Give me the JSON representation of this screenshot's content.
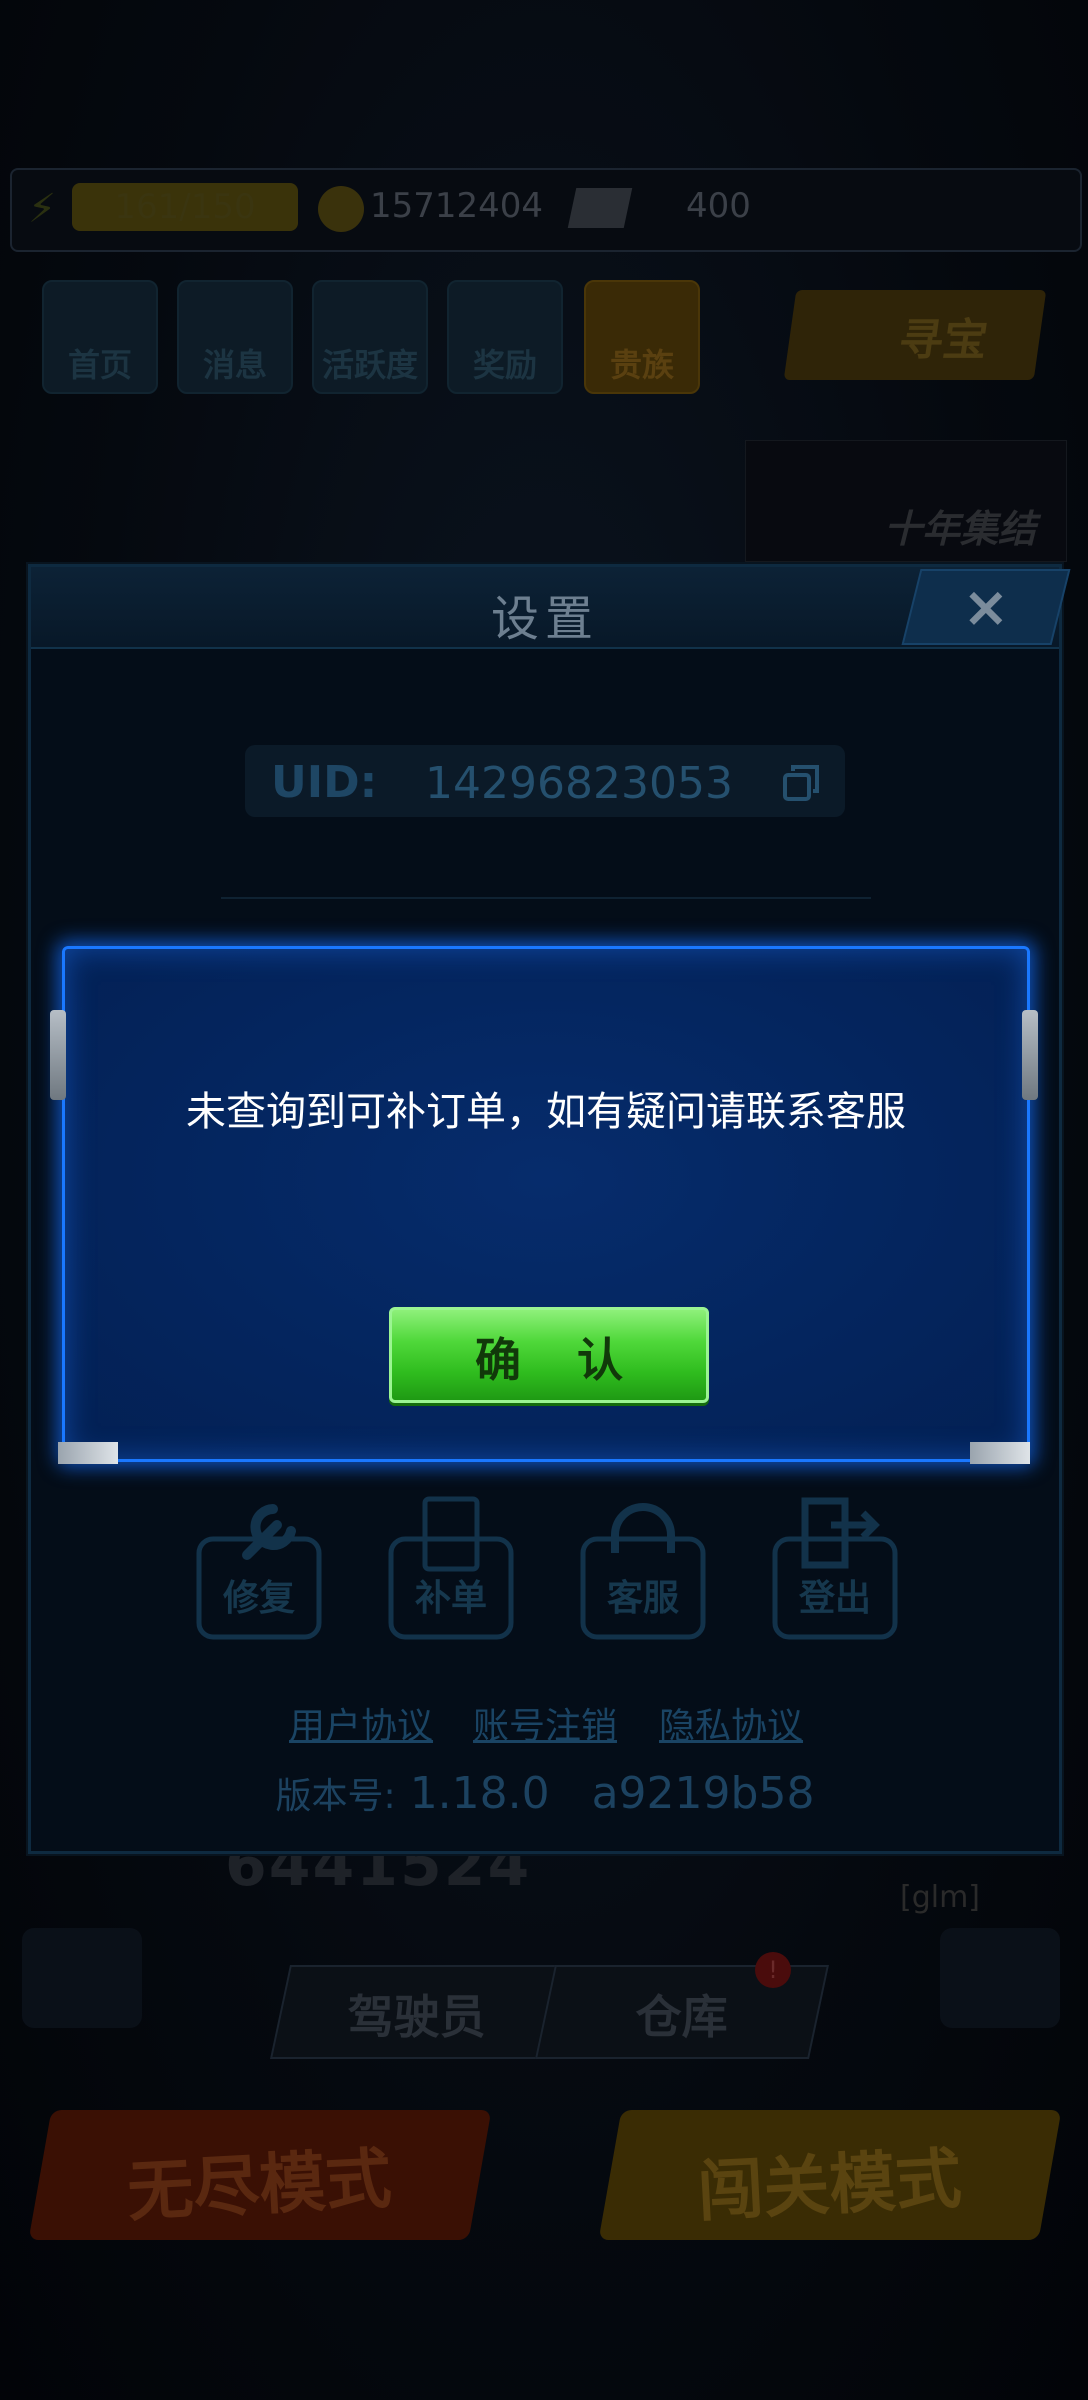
{
  "game_hud": {
    "energy": "161/150",
    "coins": "15712404",
    "tickets": "400",
    "nav": [
      "首页",
      "消息",
      "活跃度",
      "奖励",
      "贵族"
    ],
    "treasure": "寻宝",
    "banner": "十年集结",
    "score": "6441524",
    "user_tag": "[glm]",
    "driver_tab": "驾驶员",
    "warehouse_tab": "仓库",
    "warehouse_badge": "!",
    "endless_mode": "无尽模式",
    "stage_mode": "闯关模式"
  },
  "settings": {
    "title": "设置",
    "close": "×",
    "uid_label": "UID:",
    "uid_value": "14296823053",
    "tools": [
      "修复",
      "补单",
      "客服",
      "登出"
    ],
    "links": [
      "用户协议",
      "账号注销",
      "隐私协议"
    ],
    "version_label": "版本号:",
    "version_value": "1.18.0   a9219b58"
  },
  "dialog": {
    "message": "未查询到可补订单，如有疑问请联系客服",
    "confirm": "确 认"
  },
  "colors": {
    "dialog_border": "#1a78ff",
    "confirm_green": "#3fcb2a"
  }
}
